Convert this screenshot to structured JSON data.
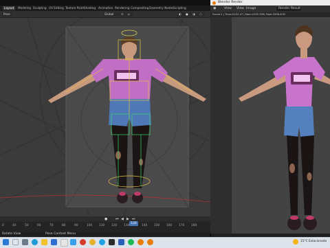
{
  "blender": {
    "workspace_tabs": [
      "Layout",
      "Modeling",
      "Sculpting",
      "UV Editing",
      "Texture Paint",
      "Shading",
      "Animation",
      "Rendering",
      "Compositing",
      "Geometry Nodes",
      "Scripting"
    ],
    "active_tab": "Layout",
    "mode": "Pose",
    "orientation": "Global",
    "timeline_ticks": [
      "0",
      "40",
      "50",
      "60",
      "70",
      "80",
      "90",
      "100",
      "110",
      "120",
      "130",
      "140",
      "150",
      "160",
      "170",
      "180"
    ],
    "current_frame": "120",
    "status_left": "Rotate View",
    "status_mid": "Pose Context Menu"
  },
  "render_window": {
    "title": "Blender Render",
    "menu": [
      "View",
      "View",
      "Image"
    ],
    "slot_label": "Render Result",
    "info": "Frame:1 | Time:00:02.47 | Mem:2295.33M, Peak:3358.41M"
  },
  "taskbar": {
    "weather": "15°C Estacionado",
    "time": "",
    "icons": [
      "windows-icon",
      "search-icon",
      "task-view-icon",
      "edge-icon",
      "explorer-icon",
      "mail-icon",
      "chrome-icon",
      "store-icon",
      "opera-icon",
      "skype-icon",
      "word-icon",
      "spotify-icon",
      "blender-icon",
      "blender2-icon"
    ]
  },
  "colors": {
    "accent": "#4772b3",
    "shirt": "#c06fc4",
    "shorts": "#4f78b6",
    "tights": "#1a1414"
  }
}
